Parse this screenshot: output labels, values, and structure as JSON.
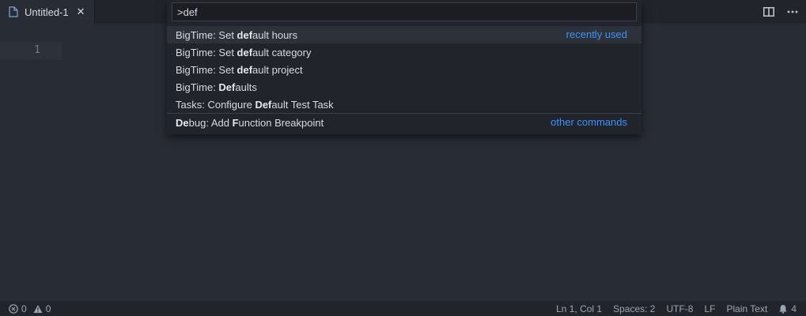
{
  "tab": {
    "title": "Untitled-1",
    "close_glyph": "✕",
    "icon": "file-icon"
  },
  "editor_actions": [
    {
      "icon": "split-editor-icon"
    },
    {
      "icon": "more-actions-icon"
    }
  ],
  "editor": {
    "line_number": "1"
  },
  "quick_open": {
    "input_value": ">def",
    "items": [
      {
        "parts": [
          {
            "t": "BigTime: Set ",
            "b": false
          },
          {
            "t": "def",
            "b": true
          },
          {
            "t": "ault hours",
            "b": false
          }
        ],
        "right": "recently used",
        "selected": true
      },
      {
        "parts": [
          {
            "t": "BigTime: Set ",
            "b": false
          },
          {
            "t": "def",
            "b": true
          },
          {
            "t": "ault category",
            "b": false
          }
        ],
        "right": "",
        "selected": false
      },
      {
        "parts": [
          {
            "t": "BigTime: Set ",
            "b": false
          },
          {
            "t": "def",
            "b": true
          },
          {
            "t": "ault project",
            "b": false
          }
        ],
        "right": "",
        "selected": false
      },
      {
        "parts": [
          {
            "t": "BigTime: ",
            "b": false
          },
          {
            "t": "Def",
            "b": true
          },
          {
            "t": "aults",
            "b": false
          }
        ],
        "right": "",
        "selected": false
      },
      {
        "parts": [
          {
            "t": "Tasks: Configure ",
            "b": false
          },
          {
            "t": "Def",
            "b": true
          },
          {
            "t": "ault Test Task",
            "b": false
          }
        ],
        "right": "",
        "selected": false
      },
      {
        "parts": [
          {
            "t": "De",
            "b": true
          },
          {
            "t": "bug: Add ",
            "b": false
          },
          {
            "t": "F",
            "b": true
          },
          {
            "t": "unction Breakpoint",
            "b": false
          }
        ],
        "right": "other commands",
        "selected": false,
        "separator": true
      }
    ]
  },
  "statusbar": {
    "errors": "0",
    "warnings": "0",
    "position": "Ln 1, Col 1",
    "spaces": "Spaces: 2",
    "encoding": "UTF-8",
    "eol": "LF",
    "language": "Plain Text",
    "notifications": "4"
  },
  "colors": {
    "background": "#282c34",
    "accent_link": "#3794ff"
  }
}
